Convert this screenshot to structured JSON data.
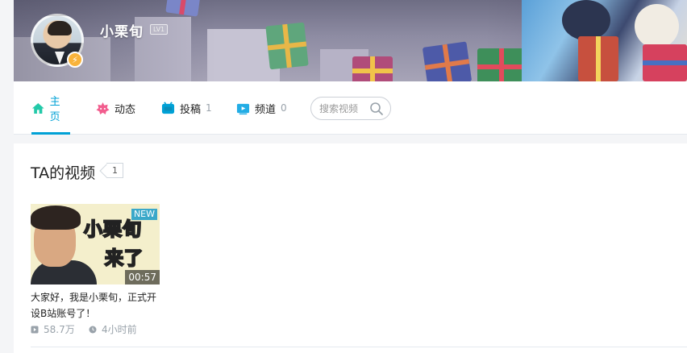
{
  "profile": {
    "username": "小栗旬",
    "level_badge": "LV1",
    "verified_glyph": "⚡"
  },
  "nav": {
    "tabs": [
      {
        "label": "主页",
        "count": "",
        "icon": "home-icon",
        "active": true
      },
      {
        "label": "动态",
        "count": "",
        "icon": "dynamic-icon",
        "active": false
      },
      {
        "label": "投稿",
        "count": "1",
        "icon": "upload-icon",
        "active": false
      },
      {
        "label": "频道",
        "count": "0",
        "icon": "channel-icon",
        "active": false
      }
    ],
    "search_placeholder": "搜索视频"
  },
  "section": {
    "title": "TA的视频",
    "count": "1"
  },
  "video": {
    "thumb_line1": "小栗旬",
    "thumb_line2": "来了",
    "new_badge": "NEW",
    "duration": "00:57",
    "title": "大家好，我是小栗旬，正式开设B站账号了！",
    "views": "58.7万",
    "time": "4小时前"
  },
  "colors": {
    "accent": "#00a1d6",
    "home_icon": "#23c9a9",
    "dynamic_icon": "#f25d8e",
    "upload_icon": "#00a1d6",
    "channel_icon": "#23ade5",
    "level_badge": "#f9b33b"
  }
}
